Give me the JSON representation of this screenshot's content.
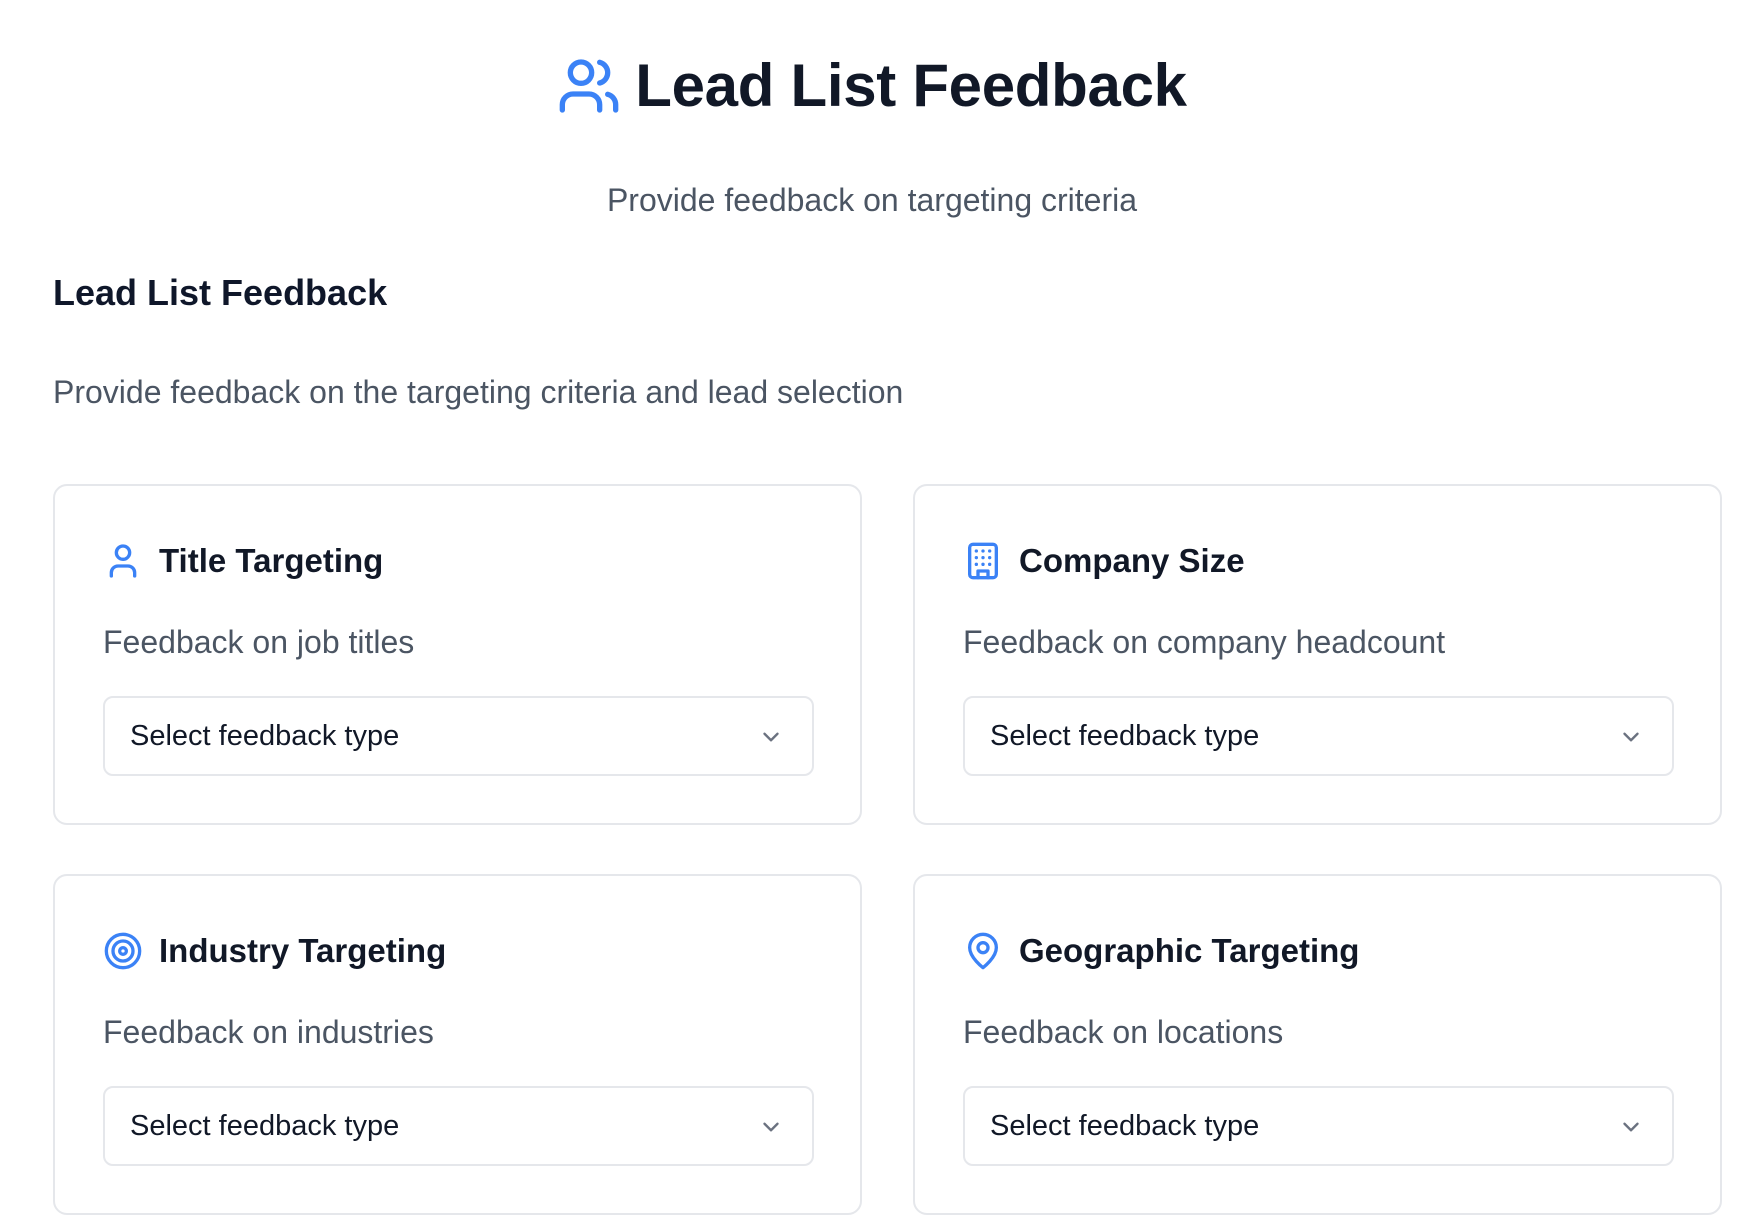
{
  "header": {
    "icon": "users-icon",
    "title": "Lead List Feedback",
    "subtitle": "Provide feedback on targeting criteria"
  },
  "section": {
    "title": "Lead List Feedback",
    "description": "Provide feedback on the targeting criteria and lead selection"
  },
  "cards": [
    {
      "icon": "user-icon",
      "title": "Title Targeting",
      "description": "Feedback on job titles",
      "select_value": "Select feedback type"
    },
    {
      "icon": "building-icon",
      "title": "Company Size",
      "description": "Feedback on company headcount",
      "select_value": "Select feedback type"
    },
    {
      "icon": "target-icon",
      "title": "Industry Targeting",
      "description": "Feedback on industries",
      "select_value": "Select feedback type"
    },
    {
      "icon": "map-pin-icon",
      "title": "Geographic Targeting",
      "description": "Feedback on locations",
      "select_value": "Select feedback type"
    }
  ],
  "colors": {
    "accent": "#3b82f6",
    "heading": "#111827",
    "muted_text": "#4b5563",
    "border": "#e5e7eb"
  }
}
